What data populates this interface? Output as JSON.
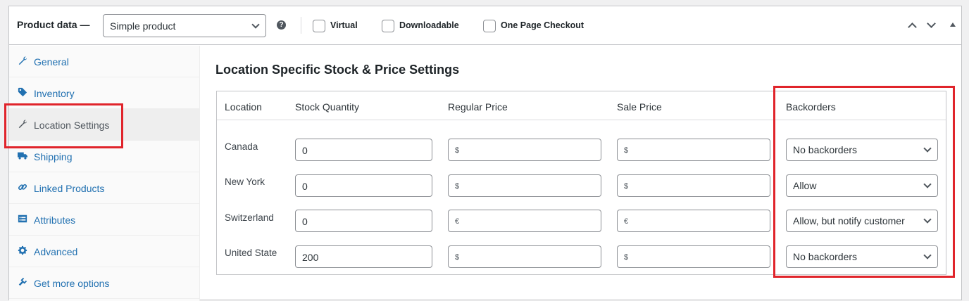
{
  "header": {
    "title": "Product data —",
    "product_type": "Simple product",
    "help_glyph": "?",
    "checkboxes": [
      {
        "label": "Virtual",
        "checked": false
      },
      {
        "label": "Downloadable",
        "checked": false
      },
      {
        "label": "One Page Checkout",
        "checked": false
      }
    ]
  },
  "sidebar": {
    "items": [
      {
        "label": "General",
        "icon": "wrench-icon"
      },
      {
        "label": "Inventory",
        "icon": "tag-icon"
      },
      {
        "label": "Location Settings",
        "icon": "wrench-icon",
        "active": true
      },
      {
        "label": "Shipping",
        "icon": "truck-icon"
      },
      {
        "label": "Linked Products",
        "icon": "link-icon"
      },
      {
        "label": "Attributes",
        "icon": "list-icon"
      },
      {
        "label": "Advanced",
        "icon": "gear-icon"
      },
      {
        "label": "Get more options",
        "icon": "plugin-icon"
      }
    ]
  },
  "main": {
    "title": "Location Specific Stock & Price Settings",
    "columns": [
      "Location",
      "Stock Quantity",
      "Regular Price",
      "Sale Price",
      "Backorders"
    ],
    "rows": [
      {
        "location": "Canada",
        "stock": "0",
        "regular_currency": "$",
        "sale_currency": "$",
        "backorders": "No backorders"
      },
      {
        "location": "New York",
        "stock": "0",
        "regular_currency": "$",
        "sale_currency": "$",
        "backorders": "Allow"
      },
      {
        "location": "Switzerland",
        "stock": "0",
        "regular_currency": "€",
        "sale_currency": "€",
        "backorders": "Allow, but notify customer"
      },
      {
        "location": "United State",
        "stock": "200",
        "regular_currency": "$",
        "sale_currency": "$",
        "backorders": "No backorders"
      }
    ]
  },
  "colors": {
    "link": "#2271b1",
    "highlight": "#e0242b",
    "border": "#c3c4c7"
  }
}
